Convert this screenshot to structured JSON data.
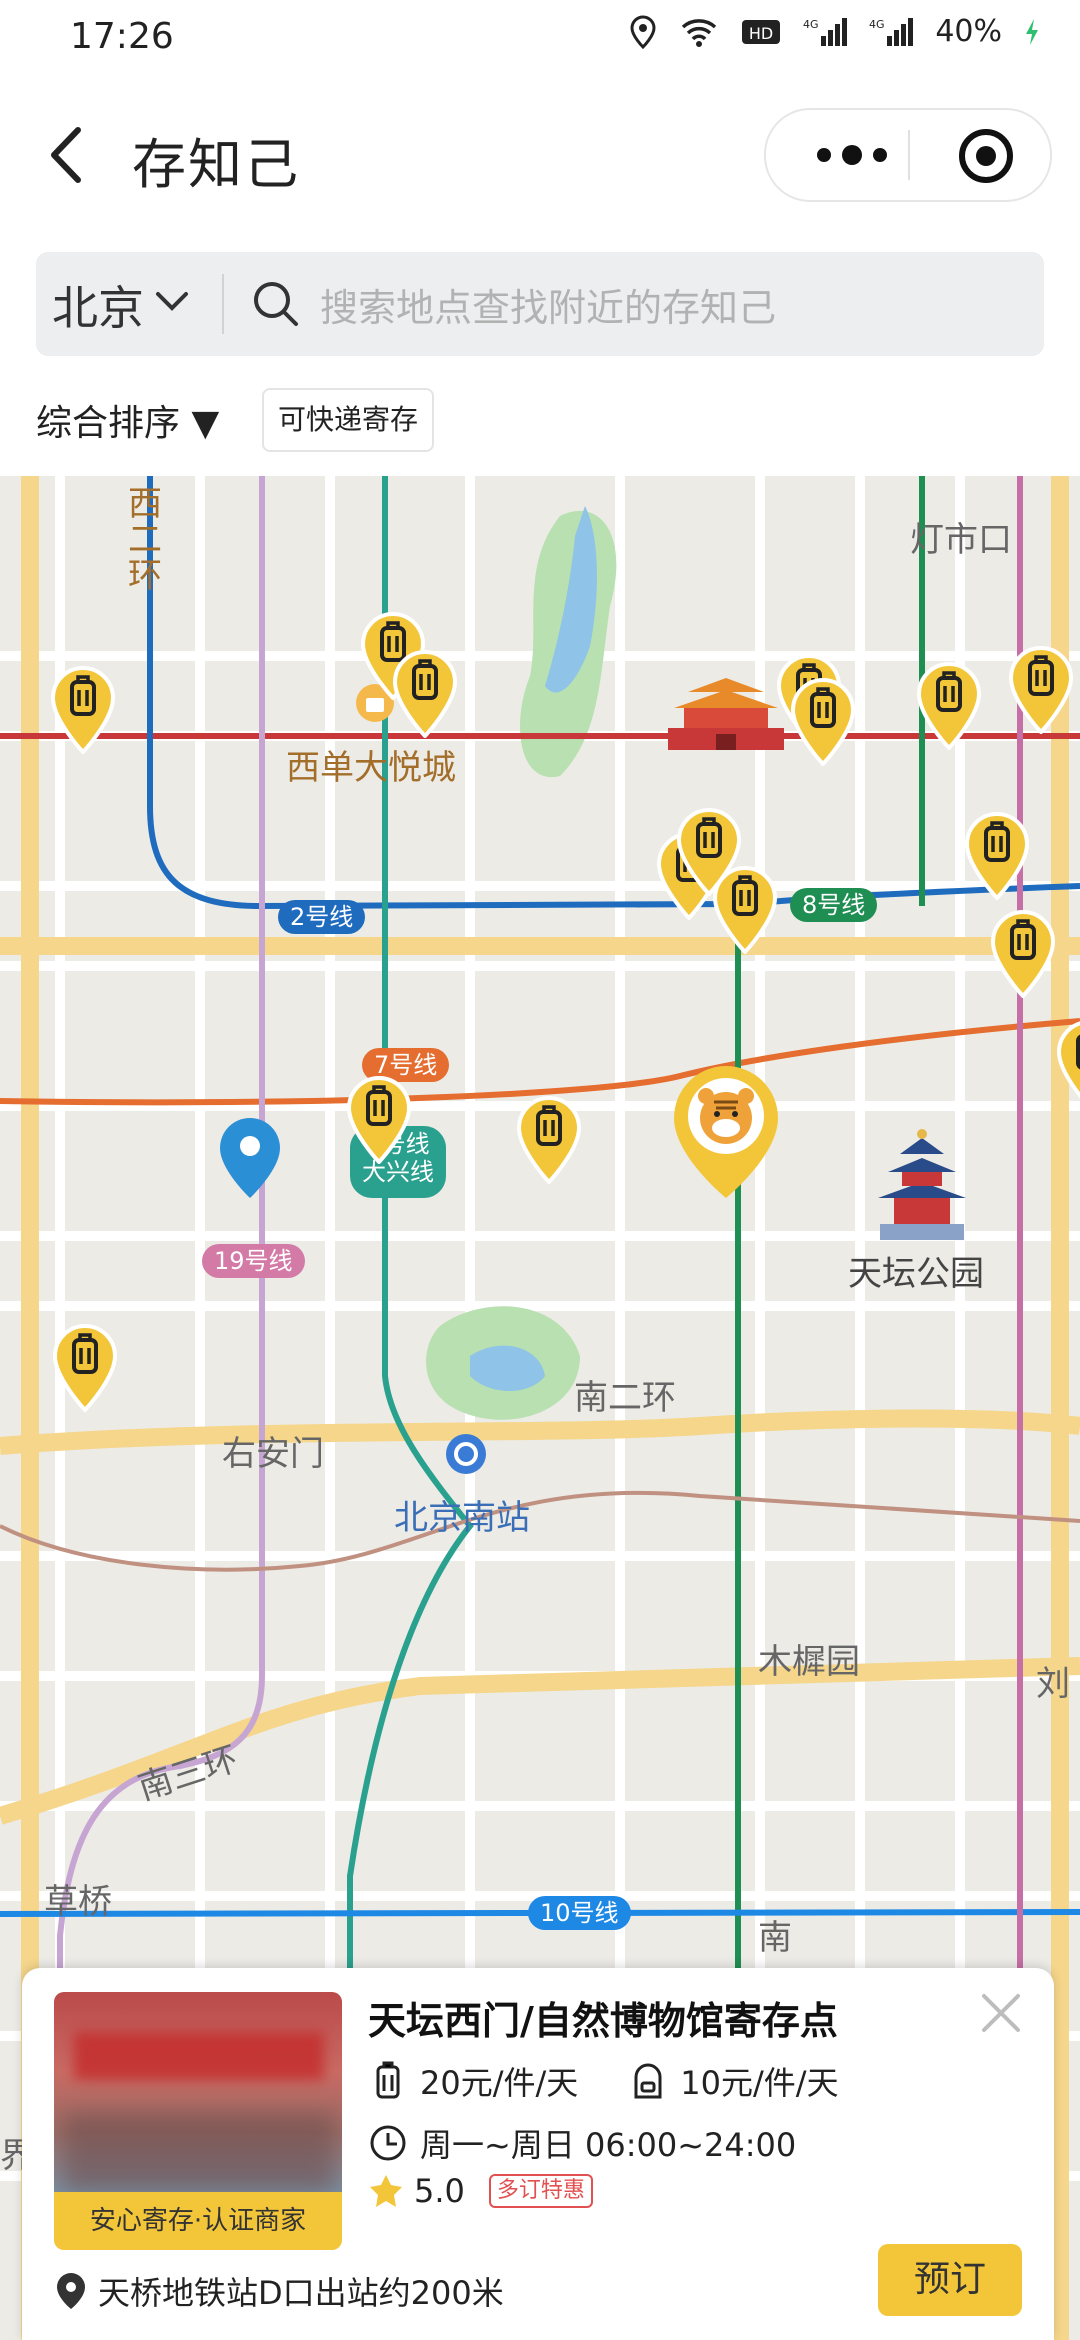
{
  "status": {
    "time": "17:26",
    "battery": "40%"
  },
  "header": {
    "title": "存知己"
  },
  "search": {
    "city": "北京",
    "placeholder": "搜索地点查找附近的存知己"
  },
  "filters": {
    "sort": "综合排序 ▼",
    "chip": "可快递寄存"
  },
  "map": {
    "labels": {
      "xi_er_huan": "西二环",
      "dengshikou": "灯市口",
      "xidan": "西单大悦城",
      "tiantan": "天坛公园",
      "youanmen": "右安门",
      "beijingnan": "北京南站",
      "nanerhuan": "南二环",
      "nansanhuan": "南三环",
      "muxiyuan": "木樨园",
      "caoqiao": "草桥",
      "liu": "刘",
      "nan": "南",
      "jie": "界"
    },
    "lines": {
      "line2": "2号线",
      "line8": "8号线",
      "line7": "7号线",
      "line4_1": "4号线",
      "line4_2": "大兴线",
      "line19": "19号线",
      "line10": "10号线"
    },
    "colors": {
      "marker": "#f3c63a",
      "line2": "#1f6cbf",
      "line8": "#1f8e53",
      "line7": "#e46d2f",
      "line4": "#2aa08e",
      "line19": "#d47aa6",
      "line10": "#1e88e5"
    }
  },
  "card": {
    "badge": "安心寄存·认证商家",
    "title": "天坛西门/自然博物馆寄存点",
    "price_suitcase": "20元/件/天",
    "price_backpack": "10元/件/天",
    "hours": "周一~周日 06:00~24:00",
    "rating": "5.0",
    "promo": "多订特惠",
    "address": "天桥地铁站D口出站约200米",
    "book": "预订"
  }
}
